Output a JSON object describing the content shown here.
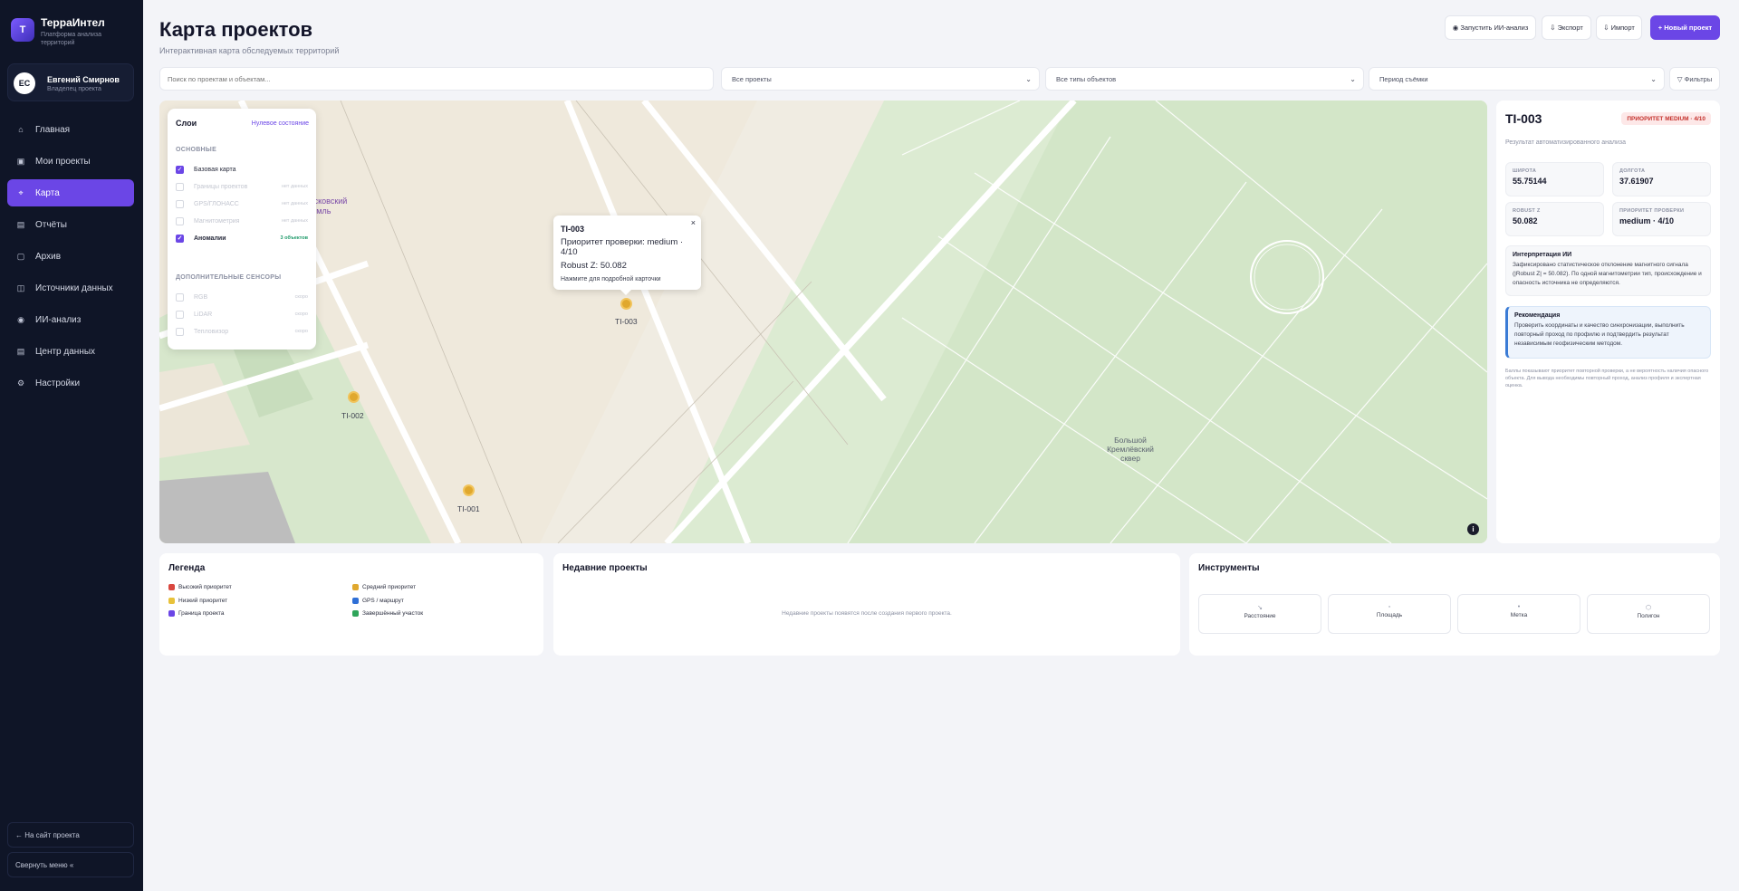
{
  "app": {
    "logo_letter": "Т",
    "name": "ТерраИнтел",
    "tagline": "Платформа анализа территорий"
  },
  "user": {
    "initials": "ЕС",
    "name": "Евгений Смирнов",
    "role": "Владелец проекта"
  },
  "nav": [
    {
      "label": "Главная",
      "icon": "home-icon",
      "glyph": "⌂",
      "active": false
    },
    {
      "label": "Мои проекты",
      "icon": "folder-icon",
      "glyph": "▣",
      "active": false
    },
    {
      "label": "Карта",
      "icon": "map-icon",
      "glyph": "⌖",
      "active": true
    },
    {
      "label": "Отчёты",
      "icon": "report-icon",
      "glyph": "▤",
      "active": false
    },
    {
      "label": "Архив",
      "icon": "archive-icon",
      "glyph": "▢",
      "active": false
    },
    {
      "label": "Источники данных",
      "icon": "data-sources-icon",
      "glyph": "◫",
      "active": false
    },
    {
      "label": "ИИ-анализ",
      "icon": "ai-icon",
      "glyph": "◉",
      "active": false
    },
    {
      "label": "Центр данных",
      "icon": "database-icon",
      "glyph": "▤",
      "active": false
    },
    {
      "label": "Настройки",
      "icon": "settings-icon",
      "glyph": "⚙",
      "active": false
    }
  ],
  "sidebar_footer": {
    "site_link": "← На сайт проекта",
    "collapse": "Свернуть меню «"
  },
  "header": {
    "title": "Карта проектов",
    "subtitle": "Интерактивная карта обследуемых территорий",
    "buttons": {
      "ai": "◉ Запустить ИИ-анализ",
      "export": "⇩ Экспорт",
      "import": "⇩ Импорт",
      "new_project": "+ Новый проект"
    }
  },
  "filters": {
    "search_placeholder": "Поиск по проектам и объектам...",
    "projects": "Все проекты",
    "object_types": "Все типы объектов",
    "period": "Период съёмки",
    "filters_button": "▽ Фильтры"
  },
  "map": {
    "labels": {
      "kremlin": "Московский\nКремль",
      "square": "Большой\nКремлёвский\nсквер"
    },
    "markers": [
      {
        "id": "TI-001"
      },
      {
        "id": "TI-002"
      },
      {
        "id": "TI-003"
      }
    ],
    "popup": {
      "title": "TI-003",
      "priority": "Приоритет проверки: medium · 4/10",
      "robust": "Robust Z: 50.082",
      "hint": "Нажмите для подробной карточки",
      "close": "×"
    },
    "info_glyph": "i"
  },
  "layers": {
    "title": "Слои",
    "zero_state": "Нулевое состояние",
    "section_main": "ОСНОВНЫЕ",
    "section_extra": "ДОПОЛНИТЕЛЬНЫЕ СЕНСОРЫ",
    "main": [
      {
        "label": "Базовая карта",
        "checked": true,
        "meta": ""
      },
      {
        "label": "Границы проектов",
        "checked": false,
        "meta": "нет данных"
      },
      {
        "label": "GPS/ГЛОНАСС",
        "checked": false,
        "meta": "нет данных"
      },
      {
        "label": "Магнитометрия",
        "checked": false,
        "meta": "нет данных"
      },
      {
        "label": "Аномалии",
        "checked": true,
        "meta": "3 объектов"
      }
    ],
    "extra": [
      {
        "label": "RGB",
        "checked": false,
        "meta": "скоро"
      },
      {
        "label": "LiDAR",
        "checked": false,
        "meta": "скоро"
      },
      {
        "label": "Тепловизор",
        "checked": false,
        "meta": "скоро"
      }
    ]
  },
  "detail": {
    "id": "TI-003",
    "badge": "ПРИОРИТЕТ MEDIUM · 4/10",
    "subtitle": "Результат автоматизированного анализа",
    "cells": [
      {
        "label": "ШИРОТА",
        "value": "55.75144"
      },
      {
        "label": "ДОЛГОТА",
        "value": "37.61907"
      },
      {
        "label": "ROBUST Z",
        "value": "50.082"
      },
      {
        "label": "ПРИОРИТЕТ ПРОВЕРКИ",
        "value": "medium · 4/10"
      }
    ],
    "interpretation_title": "Интерпретация ИИ",
    "interpretation_text": "Зафиксировано статистическое отклонение магнитного сигнала (|Robust Z| = 50.082). По одной магнитометрии тип, происхождение и опасность источника не определяются.",
    "recommendation_title": "Рекомендация",
    "recommendation_text": "Проверить координаты и качество синхронизации, выполнить повторный проход по профилю и подтвердить результат независимым геофизическим методом.",
    "note": "Баллы показывают приоритет повторной проверки, а не вероятность наличия опасного объекта. Для вывода необходимы повторный проход, анализ профиля и экспертная оценка."
  },
  "legend": {
    "title": "Легенда",
    "items": [
      {
        "label": "Высокий приоритет",
        "color": "#d9473f"
      },
      {
        "label": "Средний приоритет",
        "color": "#e0a82e"
      },
      {
        "label": "Низкий приоритет",
        "color": "#e8c23a"
      },
      {
        "label": "GPS / маршрут",
        "color": "#2f6fd6"
      },
      {
        "label": "Граница проекта",
        "color": "#6b46e6"
      },
      {
        "label": "Завершённый участок",
        "color": "#2fa55a"
      }
    ]
  },
  "recent": {
    "title": "Недавние проекты",
    "empty": "Недавние проекты появятся после создания первого проекта."
  },
  "tools": {
    "title": "Инструменты",
    "items": [
      {
        "label": "Расстояние",
        "icon": "ruler-icon",
        "glyph": "↘"
      },
      {
        "label": "Площадь",
        "icon": "area-icon",
        "glyph": "▫"
      },
      {
        "label": "Метка",
        "icon": "pin-icon",
        "glyph": "•"
      },
      {
        "label": "Полигон",
        "icon": "polygon-icon",
        "glyph": "⬡"
      }
    ]
  }
}
